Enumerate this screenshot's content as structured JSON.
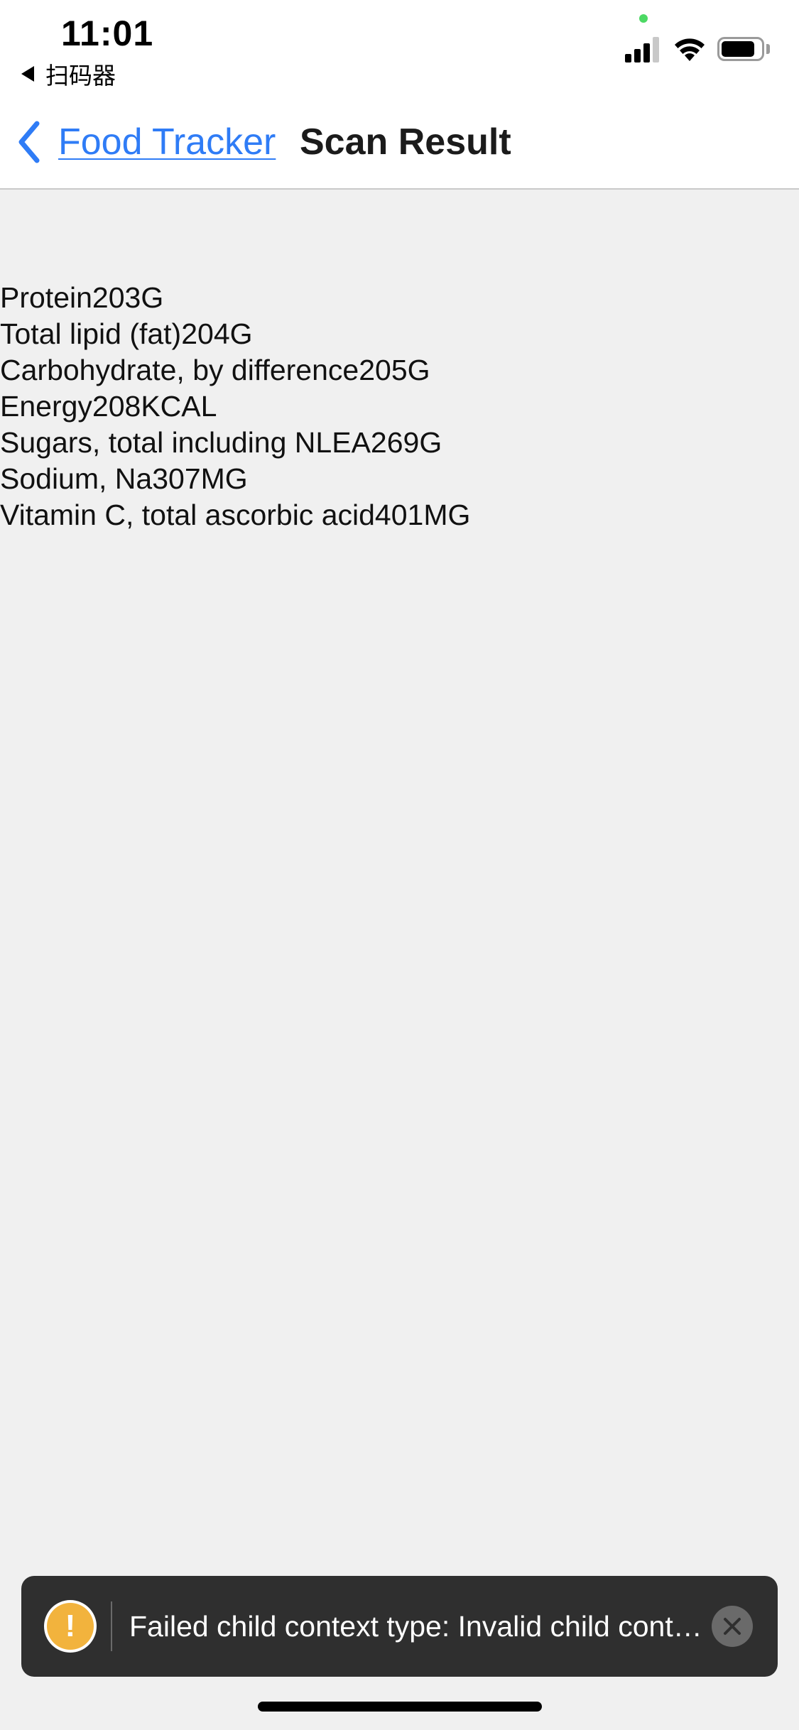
{
  "status_bar": {
    "time": "11:01",
    "back_app_label": "扫码器",
    "signal_icon": "cellular-signal-icon",
    "wifi_icon": "wifi-icon",
    "battery_icon": "battery-icon"
  },
  "nav": {
    "back_label": "Food Tracker",
    "title": "Scan Result",
    "accent_color": "#2f7cf6"
  },
  "nutrients": [
    {
      "text": "Protein203G"
    },
    {
      "text": "Total lipid (fat)204G"
    },
    {
      "text": "Carbohydrate, by difference205G"
    },
    {
      "text": "Energy208KCAL"
    },
    {
      "text": "Sugars, total including NLEA269G"
    },
    {
      "text": "Sodium, Na307MG"
    },
    {
      "text": "Vitamin C, total ascorbic acid401MG"
    }
  ],
  "toast": {
    "icon_glyph": "!",
    "message": "Failed child context type: Invalid child context `virtualizedCell.cellKey` of type `number` supplied to `CellRenderer`, expected `string`.",
    "warning_color": "#f2b33d"
  }
}
